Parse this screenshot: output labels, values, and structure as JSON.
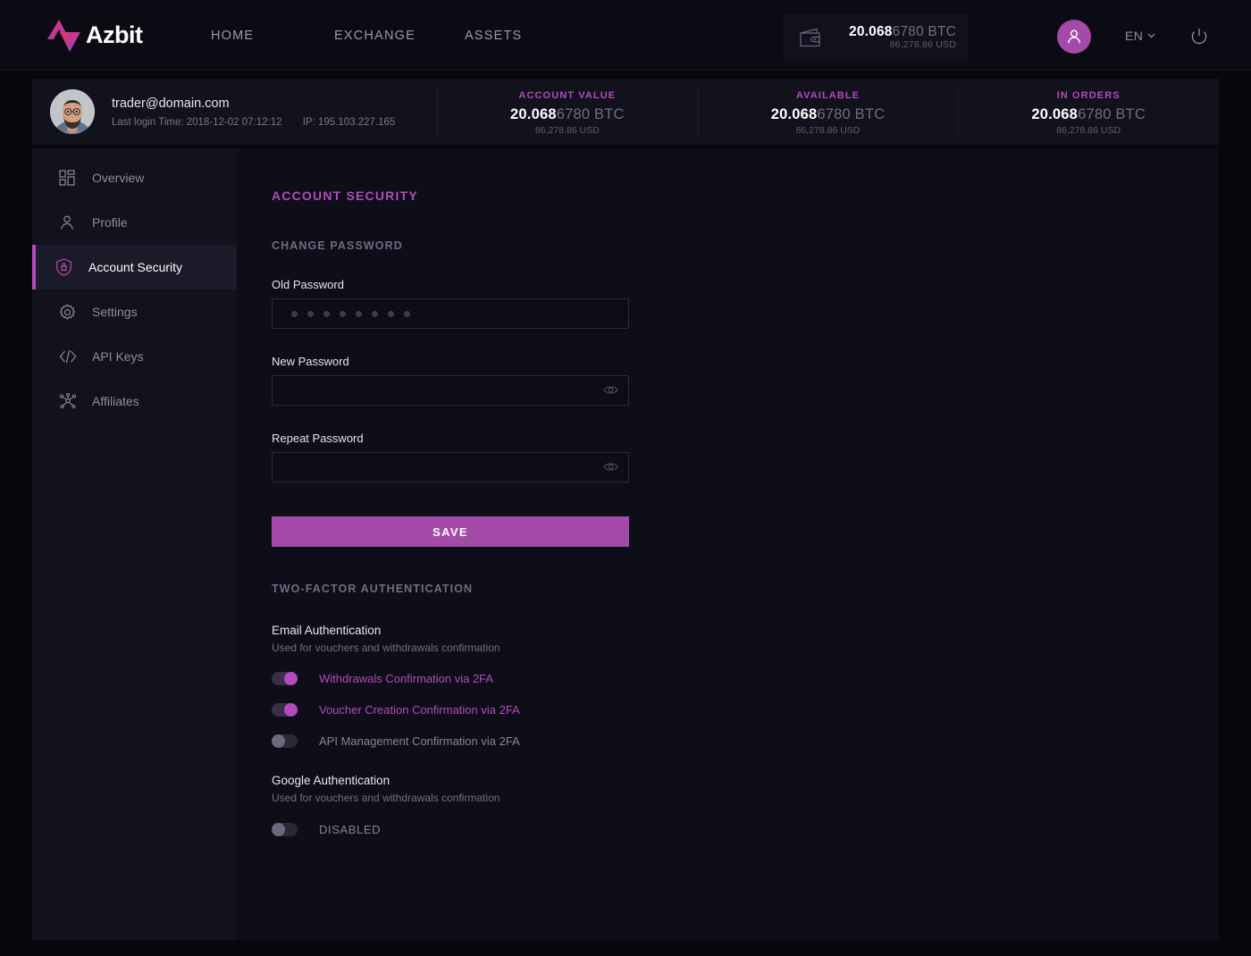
{
  "header": {
    "logo_text": "Azbit",
    "nav": [
      {
        "label": "HOME"
      },
      {
        "label": "EXCHANGE"
      },
      {
        "label": "ASSETS"
      }
    ],
    "wallet": {
      "icon": "wallet-icon",
      "btc_bold": "20.068",
      "btc_rest": "6780 BTC",
      "usd": "86,278.86 USD"
    },
    "avatar_icon": "user-icon",
    "language": "EN",
    "language_caret": "chevron-down-icon",
    "power_icon": "power-icon"
  },
  "account_bar": {
    "email": "trader@domain.com",
    "last_login_label": "Last login Time: 2018-12-02 07:12:12",
    "ip_label": "IP: 195.103.227.165",
    "stats": [
      {
        "label": "ACCOUNT VALUE",
        "btc_bold": "20.068",
        "btc_rest": "6780 BTC",
        "usd": "86,278.86 USD"
      },
      {
        "label": "AVAILABLE",
        "btc_bold": "20.068",
        "btc_rest": "6780 BTC",
        "usd": "86,278.86 USD"
      },
      {
        "label": "IN ORDERS",
        "btc_bold": "20.068",
        "btc_rest": "6780 BTC",
        "usd": "86,278.86 USD"
      }
    ]
  },
  "sidebar": {
    "items": [
      {
        "label": "Overview",
        "icon": "dashboard-icon",
        "active": false
      },
      {
        "label": "Profile",
        "icon": "user-icon",
        "active": false
      },
      {
        "label": "Account Security",
        "icon": "shield-lock-icon",
        "active": true
      },
      {
        "label": "Settings",
        "icon": "gear-icon",
        "active": false
      },
      {
        "label": "API Keys",
        "icon": "code-icon",
        "active": false
      },
      {
        "label": "Affiliates",
        "icon": "network-icon",
        "active": false
      }
    ]
  },
  "main": {
    "page_title": "ACCOUNT SECURITY",
    "change_password": {
      "section_title": "CHANGE PASSWORD",
      "old_password_label": "Old Password",
      "old_password_value": "••••••••",
      "old_password_dots": 8,
      "new_password_label": "New Password",
      "new_password_value": "",
      "repeat_password_label": "Repeat Password",
      "repeat_password_value": "",
      "reveal_icon": "eye-icon",
      "save_label": "SAVE"
    },
    "two_factor": {
      "section_title": "TWO-FACTOR AUTHENTICATION",
      "email_auth": {
        "title": "Email Authentication",
        "subtitle": "Used for vouchers and withdrawals confirmation",
        "toggles": [
          {
            "label": "Withdrawals Confirmation via 2FA",
            "state": "on"
          },
          {
            "label": "Voucher Creation Confirmation via 2FA",
            "state": "on"
          },
          {
            "label": "API Management Confirmation via 2FA",
            "state": "off"
          }
        ]
      },
      "google_auth": {
        "title": "Google Authentication",
        "subtitle": "Used for vouchers and withdrawals confirmation",
        "toggle": {
          "label": "DISABLED",
          "state": "off"
        }
      }
    }
  },
  "colors": {
    "accent_pink": "#b24bbd",
    "button_purple": "#a44aa8",
    "page_bg": "#07070d",
    "panel_bg": "#0e0e18",
    "sidebar_bg": "#12121d"
  }
}
